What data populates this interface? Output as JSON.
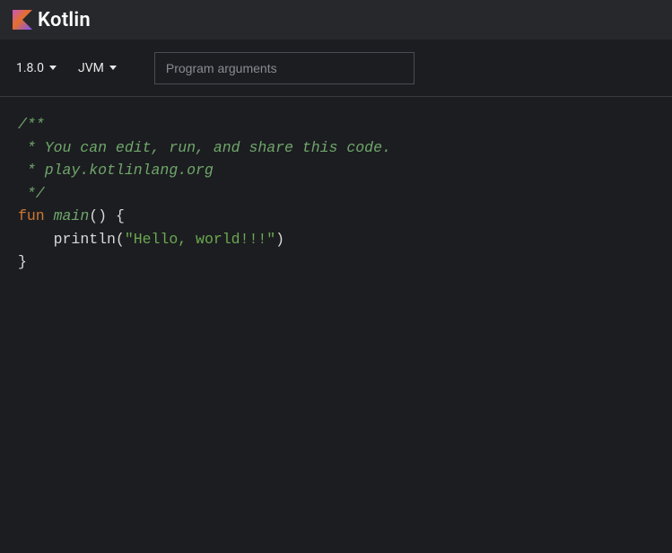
{
  "header": {
    "brand": "Kotlin"
  },
  "toolbar": {
    "version_label": "1.8.0",
    "target_label": "JVM",
    "args_placeholder": "Program arguments"
  },
  "code": {
    "c1": "/**",
    "c2": " * You can edit, run, and share this code.",
    "c3": " * play.kotlinlang.org",
    "c4": " */",
    "kw_fun": "fun",
    "fn_name": "main",
    "paren_open": "(",
    "paren_close": ")",
    "brace_open": "{",
    "indent": "    ",
    "call_name": "println",
    "str_literal": "\"Hello, world!!!\"",
    "brace_close": "}"
  }
}
